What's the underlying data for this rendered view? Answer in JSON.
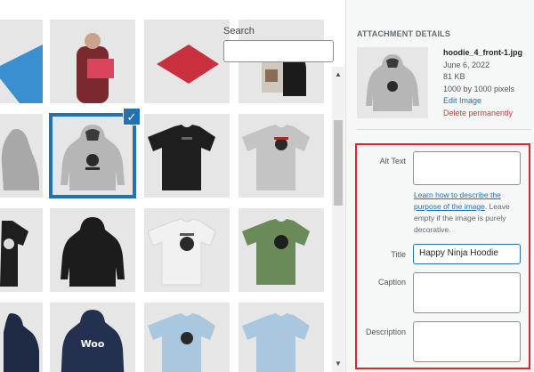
{
  "search": {
    "label": "Search",
    "value": ""
  },
  "grid": {
    "tiles": [
      {
        "row": 0,
        "col": 0,
        "kind": "cover-blue"
      },
      {
        "row": 0,
        "col": 1,
        "kind": "person-red-card"
      },
      {
        "row": 0,
        "col": 2,
        "kind": "cover-red"
      },
      {
        "row": 0,
        "col": 3,
        "kind": "album-dark"
      },
      {
        "row": 1,
        "col": 0,
        "kind": "hoodie-grey",
        "selected": false
      },
      {
        "row": 1,
        "col": 1,
        "kind": "hoodie-grey",
        "selected": true
      },
      {
        "row": 1,
        "col": 2,
        "kind": "tshirt-black"
      },
      {
        "row": 1,
        "col": 3,
        "kind": "tshirt-grey"
      },
      {
        "row": 2,
        "col": 0,
        "kind": "tshirt-black"
      },
      {
        "row": 2,
        "col": 1,
        "kind": "hoodie-black"
      },
      {
        "row": 2,
        "col": 2,
        "kind": "tshirt-white"
      },
      {
        "row": 2,
        "col": 3,
        "kind": "tshirt-green"
      },
      {
        "row": 3,
        "col": 0,
        "kind": "hoodie-navy"
      },
      {
        "row": 3,
        "col": 1,
        "kind": "hoodie-navy-woo"
      },
      {
        "row": 3,
        "col": 2,
        "kind": "tshirt-lightblue"
      },
      {
        "row": 3,
        "col": 3,
        "kind": "tshirt-lightblue"
      }
    ],
    "check_mark": "✓"
  },
  "scrollbar": {
    "up": "▲",
    "down": "▼"
  },
  "details": {
    "heading": "ATTACHMENT DETAILS",
    "filename": "hoodie_4_front-1.jpg",
    "date": "June 6, 2022",
    "size": "81 KB",
    "dimensions": "1000 by 1000 pixels",
    "edit_link": "Edit Image",
    "delete_link": "Delete permanently"
  },
  "fields": {
    "alt_text_label": "Alt Text",
    "alt_text_value": "",
    "help_link": "Learn how to describe the purpose of the image",
    "help_rest": ". Leave empty if the image is purely decorative.",
    "title_label": "Title",
    "title_value": "Happy Ninja Hoodie",
    "caption_label": "Caption",
    "caption_value": "",
    "description_label": "Description",
    "description_value": ""
  },
  "colors": {
    "accent": "#2271b1",
    "danger": "#d63638",
    "highlight": "#e0242a"
  }
}
